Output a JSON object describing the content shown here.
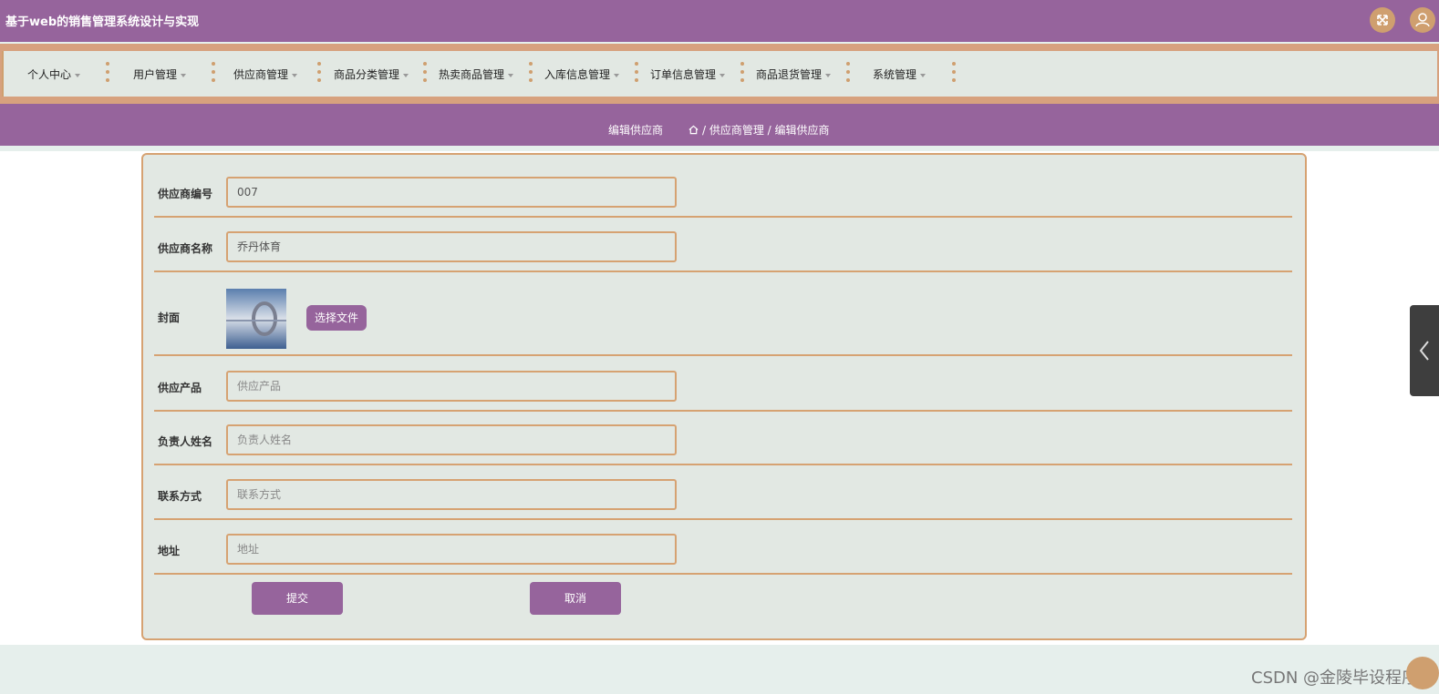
{
  "app": {
    "title": "基于web的销售管理系统设计与实现"
  },
  "header_icons": [
    "fullscreen-icon",
    "user-icon"
  ],
  "nav": {
    "items": [
      {
        "label": "个人中心"
      },
      {
        "label": "用户管理"
      },
      {
        "label": "供应商管理"
      },
      {
        "label": "商品分类管理"
      },
      {
        "label": "热卖商品管理"
      },
      {
        "label": "入库信息管理"
      },
      {
        "label": "订单信息管理"
      },
      {
        "label": "商品退货管理"
      },
      {
        "label": "系统管理"
      }
    ]
  },
  "page": {
    "title": "编辑供应商",
    "breadcrumb": "/ 供应商管理 / 编辑供应商"
  },
  "form": {
    "supplier_id": {
      "label": "供应商编号",
      "value": "007"
    },
    "supplier_name": {
      "label": "供应商名称",
      "value": "乔丹体育"
    },
    "cover": {
      "label": "封面",
      "button": "选择文件"
    },
    "product": {
      "label": "供应产品",
      "placeholder": "供应产品"
    },
    "contact_person": {
      "label": "负责人姓名",
      "placeholder": "负责人姓名"
    },
    "phone": {
      "label": "联系方式",
      "placeholder": "联系方式"
    },
    "address": {
      "label": "地址",
      "placeholder": "地址"
    },
    "submit_label": "提交",
    "cancel_label": "取消"
  },
  "watermark": "CSDN @金陵毕设程序",
  "colors": {
    "primary": "#96649c",
    "accent": "#d6a272",
    "panel": "#e2e8e3"
  }
}
